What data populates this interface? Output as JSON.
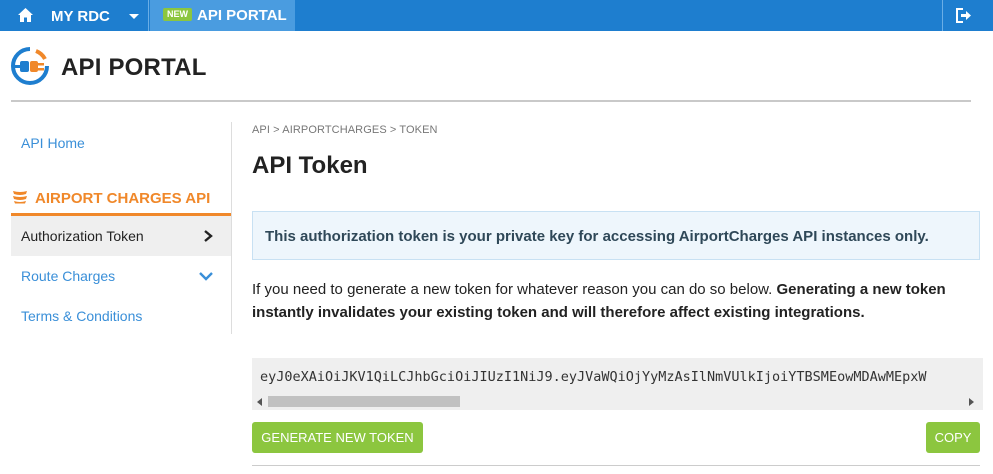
{
  "topbar": {
    "home_label": "MY RDC",
    "new_badge": "NEW",
    "portal_label": "API PORTAL",
    "icons": [
      "home-icon",
      "caret-down-icon",
      "logout-icon"
    ],
    "colors": {
      "bar": "#1e7ecf",
      "active_tab": "#4a9ce0",
      "badge": "#8cc63f"
    }
  },
  "header": {
    "title": "API PORTAL",
    "logo_icon": "api-plug-logo"
  },
  "sidebar": {
    "home": "API Home",
    "section_title": "AIRPORT CHARGES API",
    "section_icon": "flame-icon",
    "items": [
      {
        "label": "Authorization Token",
        "active": true,
        "icon": "chevron-right-icon"
      },
      {
        "label": "Route Charges",
        "active": false,
        "icon": "chevron-down-icon"
      },
      {
        "label": "Terms & Conditions",
        "active": false
      }
    ],
    "colors": {
      "link": "#3a8fd8",
      "section": "#f0882a"
    }
  },
  "main": {
    "breadcrumb": "API > AIRPORTCHARGES > TOKEN",
    "title": "API Token",
    "info": "This authorization token is your private key for accessing AirportCharges API instances only.",
    "paragraph_plain": "If you need to generate a new token for whatever reason you can do so below. ",
    "paragraph_bold": "Generating a new token instantly invalidates your existing token and will therefore affect existing integrations.",
    "token": "eyJ0eXAiOiJKV1QiLCJhbGciOiJIUzI1NiJ9.eyJVaWQiOjYyMzAsIlNmVUlkIjoiYTBSMEowMDAwMEpxW",
    "generate_button": "GENERATE NEW TOKEN",
    "copy_button": "COPY"
  }
}
